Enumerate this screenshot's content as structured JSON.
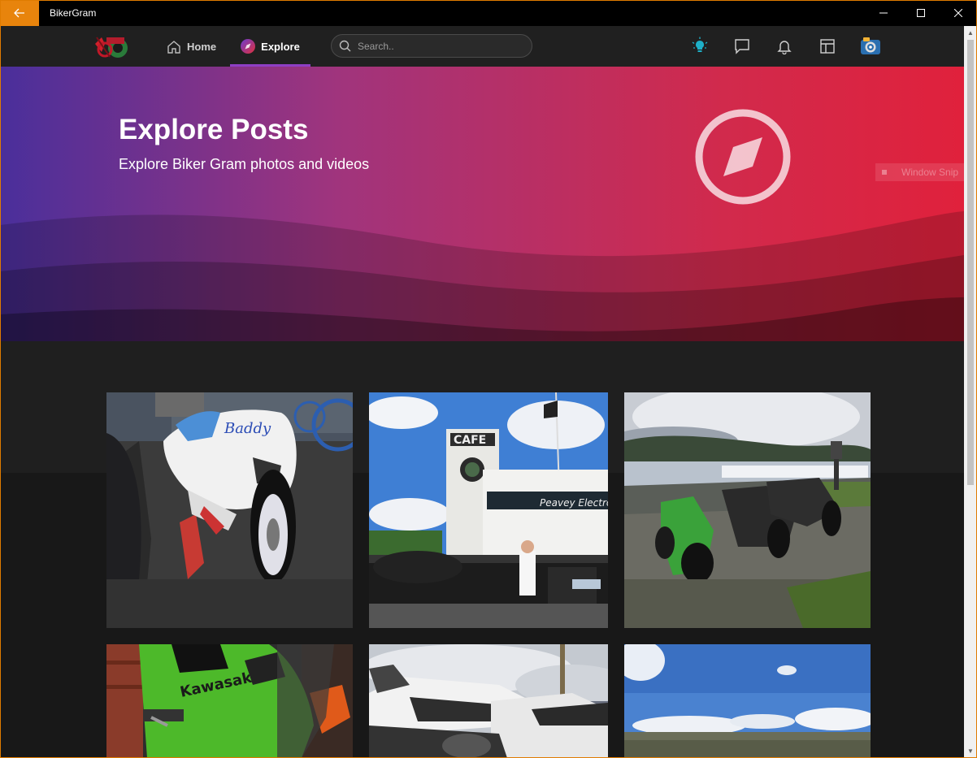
{
  "window": {
    "title": "BikerGram",
    "accent": "#e8840c"
  },
  "nav": {
    "logo_icon": "bikergram-logo",
    "home_label": "Home",
    "explore_label": "Explore",
    "search_placeholder": "Search..",
    "icons": [
      "lightbulb-icon",
      "chat-icon",
      "bell-icon",
      "layout-icon",
      "camera-icon"
    ]
  },
  "hero": {
    "title": "Explore Posts",
    "subtitle": "Explore Biker Gram photos and videos",
    "icon": "compass-icon",
    "gradient_colors": [
      "#4a2f9b",
      "#a0347d",
      "#e0213c"
    ]
  },
  "tooltip": {
    "label": "Window Snip"
  },
  "posts": [
    {
      "subject": "white sport motorcycle",
      "sign": "Baddy"
    },
    {
      "subject": "cafe riders group",
      "sign": "CAFE",
      "sign2": "Peavey Electro"
    },
    {
      "subject": "motorcycles by a lake"
    },
    {
      "subject": "green kawasaki",
      "sign": "Kawasaki"
    },
    {
      "subject": "white sport bikes under clouds"
    },
    {
      "subject": "moorland sky"
    }
  ]
}
